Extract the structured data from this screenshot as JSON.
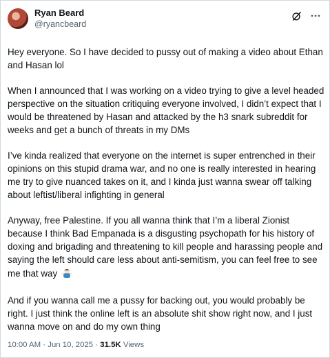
{
  "author": {
    "display_name": "Ryan Beard",
    "handle": "@ryancbeard"
  },
  "icons": {
    "avatar": "avatar",
    "grok": "grok-icon",
    "more": "more-icon",
    "emoji": "man-shrugging-emoji"
  },
  "body": {
    "p1": "Hey everyone. So I have decided to pussy out of making a video about Ethan and Hasan lol",
    "p2": "When I announced that I was working on a video trying to give a level headed perspective on the situation critiquing everyone involved, I didn’t expect that I would be threatened by Hasan and attacked by the h3 snark subreddit for weeks and get a bunch of threats in my DMs",
    "p3": "I’ve kinda realized that everyone on the internet is super entrenched in their opinions on this stupid drama war, and no one is really interested in hearing me try to give nuanced takes on it, and I kinda just wanna swear off talking about leftist/liberal infighting in general",
    "p4": "Anyway, free Palestine. If you all wanna think that I’m a liberal Zionist because I think Bad Empanada is a disgusting psychopath for his history of doxing and brigading and threatening to kill people and harassing people and saying the left should care less about anti-semitism, you can feel free to see me that way",
    "p5": "And if you wanna call me a pussy for backing out, you would probably be right. I just think the online left is an absolute shit show right now, and I just wanna move on and do my own thing"
  },
  "meta": {
    "time": "10:00 AM",
    "separator": " · ",
    "date": "Jun 10, 2025",
    "separator2": " · ",
    "views_count": "31.5K",
    "views_label": " Views"
  },
  "colors": {
    "text": "#0f1419",
    "secondary": "#536471",
    "border": "#cfd9de"
  }
}
